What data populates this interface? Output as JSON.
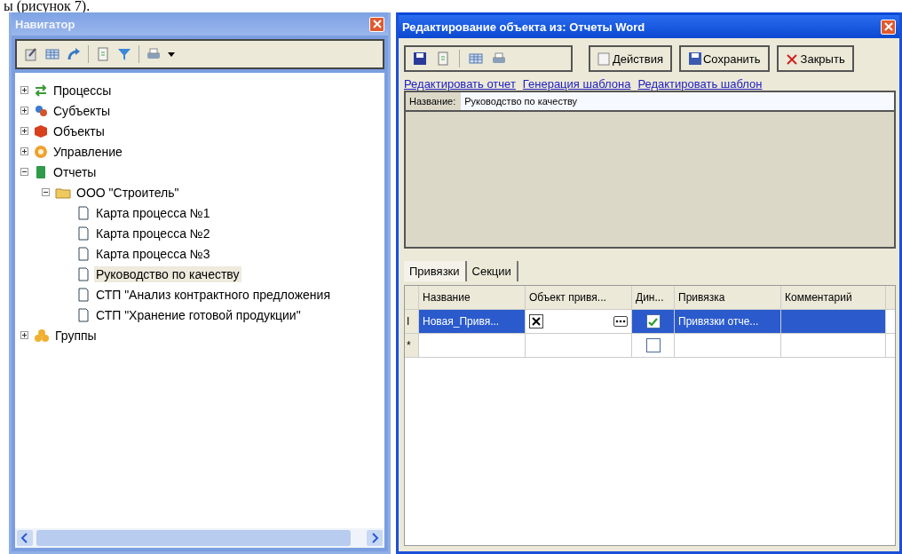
{
  "caption": "ы (рисунок 7).",
  "navigator": {
    "title": "Навигатор",
    "tree": [
      {
        "label": "Процессы",
        "kind": "process",
        "expanded": false,
        "selected": false
      },
      {
        "label": "Субъекты",
        "kind": "subjects",
        "expanded": false,
        "selected": false
      },
      {
        "label": "Объекты",
        "kind": "objects",
        "expanded": false,
        "selected": false
      },
      {
        "label": "Управление",
        "kind": "management",
        "expanded": false,
        "selected": false
      },
      {
        "label": "Отчеты",
        "kind": "reports",
        "expanded": true,
        "selected": false,
        "children": [
          {
            "label": "ООО \"Строитель\"",
            "kind": "folder",
            "expanded": true,
            "selected": false,
            "children": [
              {
                "label": "Карта процесса №1",
                "kind": "document",
                "selected": false
              },
              {
                "label": "Карта процесса №2",
                "kind": "document",
                "selected": false
              },
              {
                "label": "Карта процесса №3",
                "kind": "document",
                "selected": false
              },
              {
                "label": "Руководство по качеству",
                "kind": "document",
                "selected": true
              },
              {
                "label": "СТП \"Анализ контрактного предложения",
                "kind": "document",
                "selected": false
              },
              {
                "label": "СТП \"Хранение готовой продукции\"",
                "kind": "document",
                "selected": false
              }
            ]
          }
        ]
      },
      {
        "label": "Группы",
        "kind": "groups",
        "expanded": false,
        "selected": false
      }
    ]
  },
  "editor": {
    "title": "Редактирование объекта из: Отчеты Word",
    "buttons": [
      "Действия",
      "Сохранить",
      "Закрыть"
    ],
    "links": [
      "Редактировать отчет",
      "Генерация шаблона",
      "Редактировать шаблон"
    ],
    "name_label": "Название:",
    "name_value": "Руководство по качеству",
    "tabs": [
      {
        "label": "Привязки",
        "selected": true
      },
      {
        "label": "Секции",
        "selected": false
      }
    ],
    "grid": {
      "columns": [
        "Название",
        "Объект привя...",
        "Дин...",
        "Привязка",
        "Комментарий"
      ],
      "rows": [
        {
          "marker": "I",
          "selected": true,
          "name": "Новая_Привя...",
          "object_set": true,
          "dynamic": true,
          "binding": "Привязки отче...",
          "comment": ""
        },
        {
          "marker": "*",
          "selected": false,
          "name": "",
          "object_set": false,
          "dynamic": false,
          "binding": "",
          "comment": ""
        }
      ]
    }
  }
}
